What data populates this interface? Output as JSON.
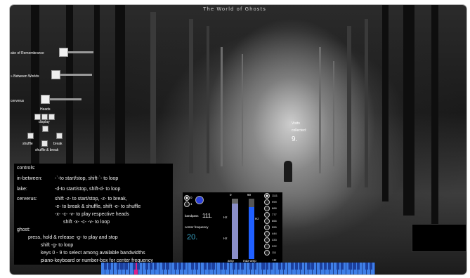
{
  "app": {
    "title": "The World of Ghosts"
  },
  "sliders": [
    {
      "label": "ake of Remembrance",
      "value": 0.1
    },
    {
      "label": "» Between Worlds",
      "value": 0.1
    },
    {
      "label": "cerverus",
      "value": 0.1
    }
  ],
  "heads": {
    "heading": "Heads",
    "display_label": "display",
    "shuffle_label": "shuffle",
    "break_label": "break",
    "shuffle_break_label": "shuffle & break"
  },
  "stats": {
    "label_line1": "Visits",
    "label_line2": "collected:",
    "value": "9."
  },
  "controls": {
    "heading": "controls:",
    "lines": [
      {
        "key": "in-between:",
        "text": "-`-to start/stop, shift-`- to loop"
      },
      {
        "key": "lake:",
        "text": "-d-to start/stop, shift-d- to loop"
      },
      {
        "key": "cerverus:",
        "text": "shift -z- to start/stop, -z- to break,"
      },
      {
        "key": "",
        "text": "-e- to break & shuffle, shift -e- to shuffle"
      },
      {
        "key": "",
        "text": "-x- -c- -v- to play respective heads"
      },
      {
        "key": "",
        "text": "shift -x- -c- -v- to loop"
      },
      {
        "key": "ghost:",
        "text": ""
      },
      {
        "key": "",
        "text": "press, hold & release -g- to play and stop"
      },
      {
        "key": "",
        "text": "shift -g- to loop"
      },
      {
        "key": "",
        "text": "keys 0 - 9 to select among available bandwidths"
      },
      {
        "key": "",
        "text": "piano-keyboard or number-box for center frequency"
      }
    ]
  },
  "ghost_panel": {
    "toggle_on": "0",
    "toggle_off": "1",
    "bandpass_label": "bandpass",
    "bandpass_value": "111.",
    "center_frequency_label": "center frequency",
    "center_frequency_value": "20.",
    "amp_label": "amp",
    "amp_value": "0",
    "amp_unit": "Hz",
    "max_amp_label": "max-amp",
    "max_amp_value": "90",
    "max_amp_unit": "Hz",
    "amp_unit2": "Hz",
    "amp_level": 0.92,
    "max_amp_level": 0.86,
    "bandwidths": [
      "1111",
      "999",
      "888",
      "777",
      "666",
      "555",
      "444",
      "333",
      "222",
      "111"
    ],
    "bandwidth_unit": "Hz"
  },
  "piano": {
    "white_keys": 66,
    "highlight_key": 8
  },
  "colors": {
    "piano": "#3f7fe8",
    "highlight": "#e0208a",
    "meter": "#2060ff",
    "center_freq": "#3aa6c8"
  }
}
